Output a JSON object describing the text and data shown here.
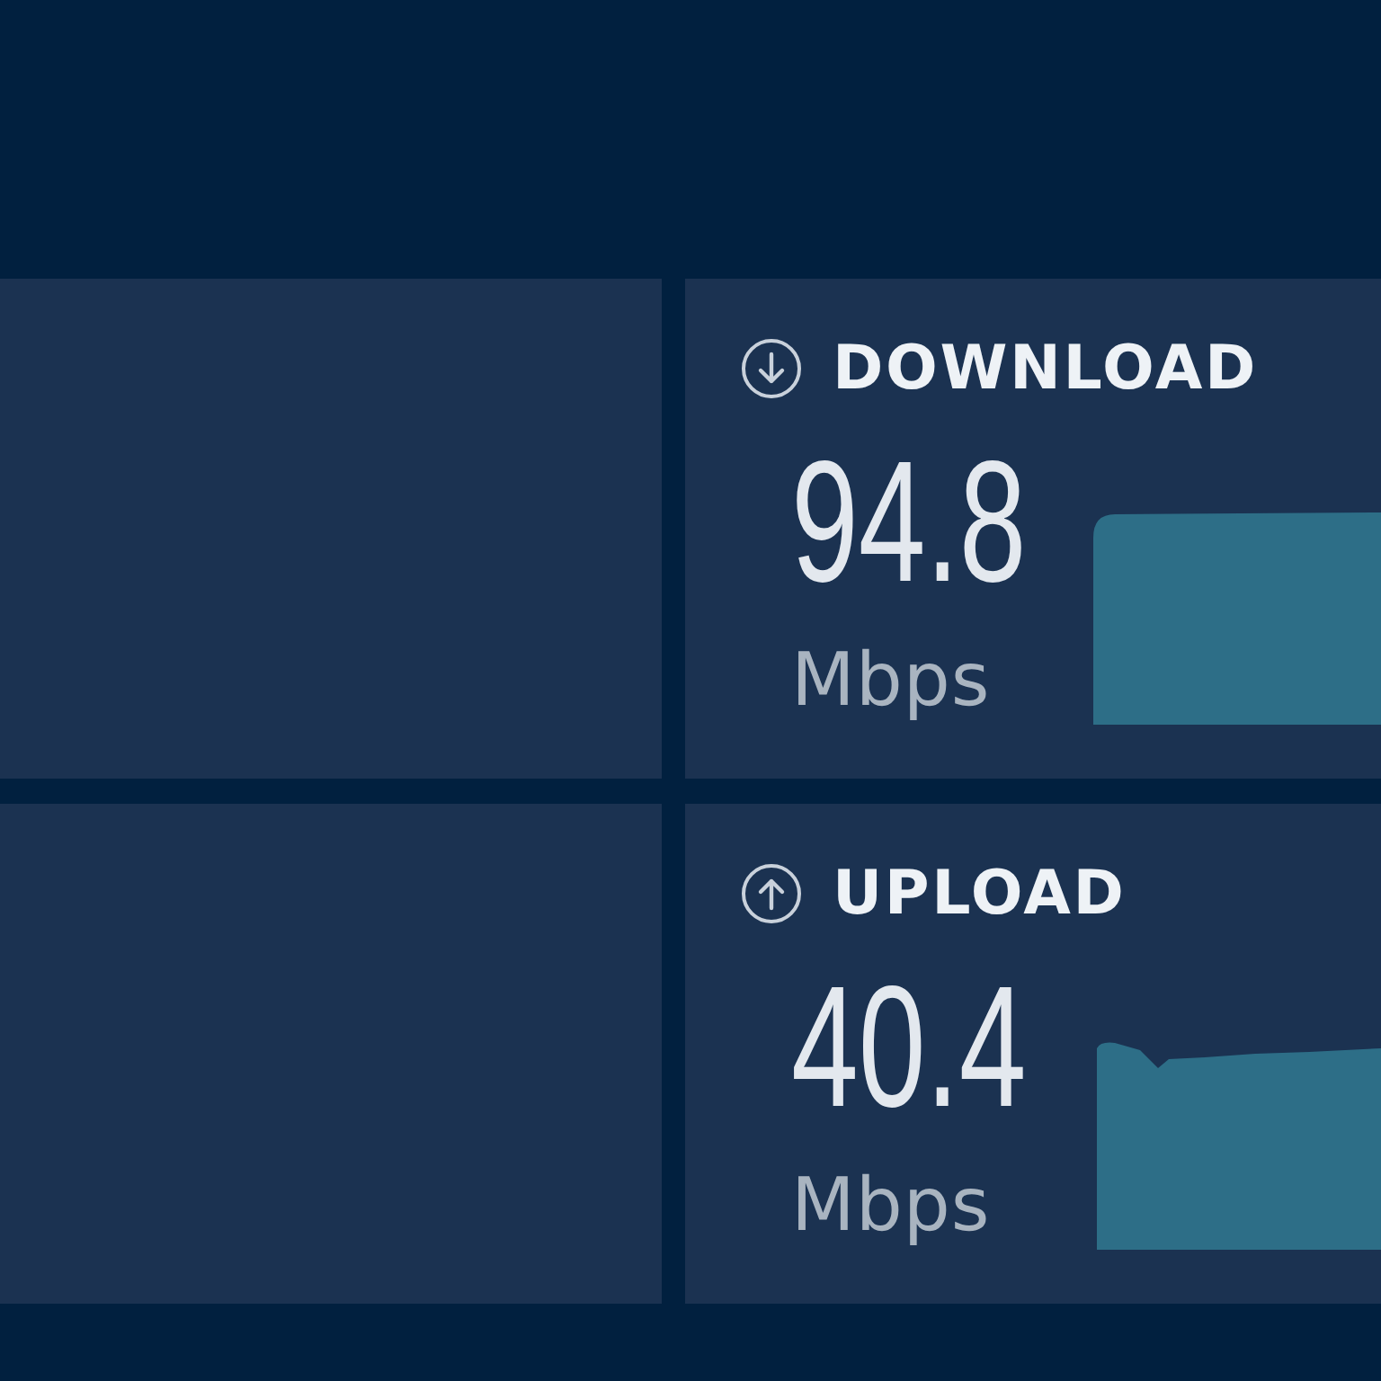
{
  "metrics": [
    {
      "kind": "download",
      "label": "DOWNLOAD",
      "value": "94.8",
      "unit": "Mbps"
    },
    {
      "kind": "upload",
      "label": "UPLOAD",
      "value": "40.4",
      "unit": "Mbps"
    }
  ]
}
